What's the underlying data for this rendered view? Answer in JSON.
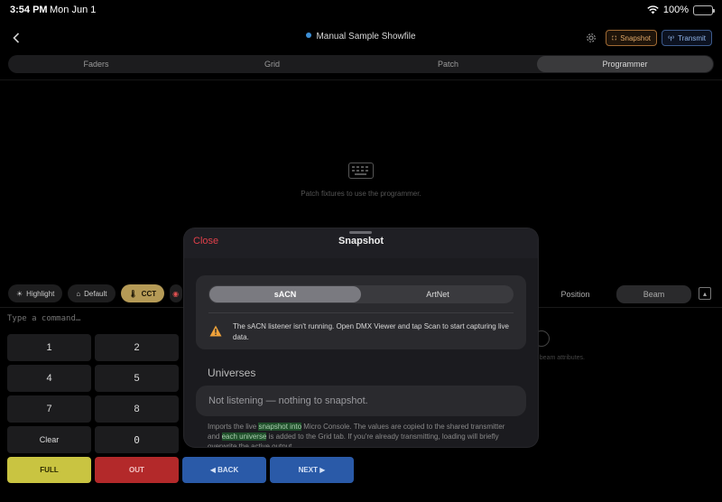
{
  "status_bar": {
    "time": "3:54 PM",
    "date": "Mon Jun 1",
    "battery": "100%"
  },
  "nav": {
    "title": "Manual Sample Showfile",
    "snapshot_label": "Snapshot",
    "transmit_label": "Transmit"
  },
  "tabs": [
    {
      "label": "Faders",
      "active": false
    },
    {
      "label": "Grid",
      "active": false
    },
    {
      "label": "Patch",
      "active": false
    },
    {
      "label": "Programmer",
      "active": true
    }
  ],
  "empty_state": {
    "message": "Patch fixtures to use the programmer."
  },
  "chips": [
    {
      "label": "Highlight"
    },
    {
      "label": "Default"
    },
    {
      "label": "CCT"
    }
  ],
  "attribute_tabs": [
    {
      "label": "Position",
      "active": false
    },
    {
      "label": "Beam",
      "active": true
    }
  ],
  "right_hint": "et beam attributes.",
  "command": {
    "placeholder": "Type a command…"
  },
  "keypad": {
    "k1": "1",
    "k2": "2",
    "k4": "4",
    "k5": "5",
    "k7": "7",
    "k8": "8",
    "clear": "Clear",
    "k0": "0"
  },
  "actions": {
    "full": "FULL",
    "out": "OUT",
    "back": "◀ BACK",
    "next": "NEXT ▶"
  },
  "sheet": {
    "close": "Close",
    "title": "Snapshot",
    "segments": [
      {
        "label": "sACN",
        "active": true
      },
      {
        "label": "ArtNet",
        "active": false
      }
    ],
    "warning": "The sACN listener isn't running. Open DMX Viewer and tap Scan to start capturing live data.",
    "universes_label": "Universes",
    "universes_status": "Not listening — nothing to snapshot.",
    "import_text_1": "Imports the live ",
    "import_text_hl1": "snapshot into",
    "import_text_2": " Micro Console. The values are copied to the shared transmitter and ",
    "import_text_hl2": "each universe",
    "import_text_3": " is added to the Grid tab. If you're already transmitting, loading will briefly overwrite the active output."
  },
  "colors": {
    "accent_blue": "#3d8fd6",
    "close_red": "#e0404a",
    "cct_gold": "#b59a56",
    "full_yellow": "#c9c441",
    "out_red": "#b3292a",
    "nav_blue": "#2a5aa8"
  }
}
